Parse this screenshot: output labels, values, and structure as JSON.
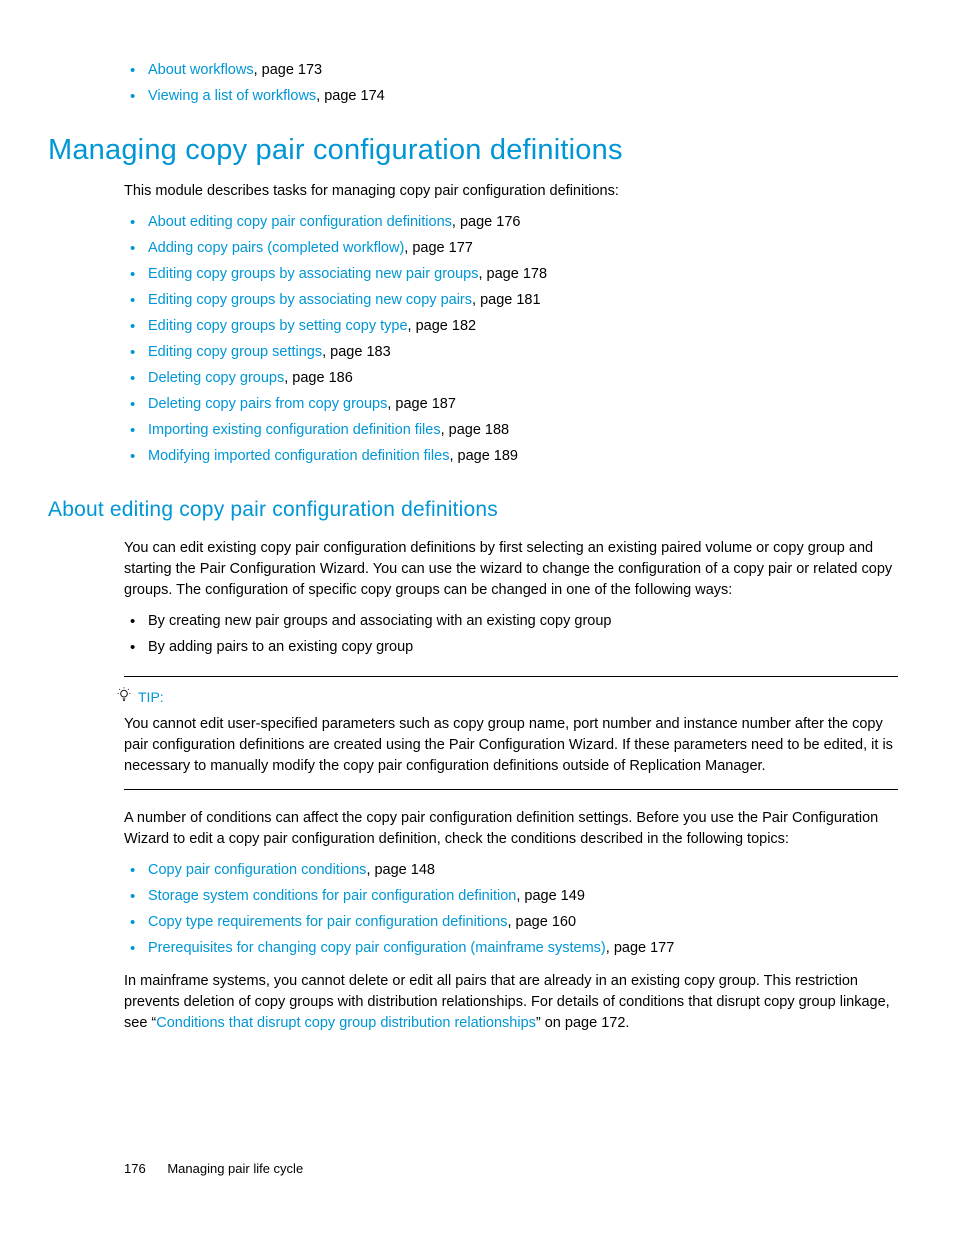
{
  "top_list": [
    {
      "link": "About workflows",
      "suffix": ", page 173"
    },
    {
      "link": "Viewing a list of workflows",
      "suffix": ", page 174"
    }
  ],
  "h1": "Managing copy pair configuration definitions",
  "intro_para": "This module describes tasks for managing copy pair configuration definitions:",
  "main_list": [
    {
      "link": "About editing copy pair configuration definitions",
      "suffix": ", page 176"
    },
    {
      "link": "Adding copy pairs (completed workflow)",
      "suffix": ", page 177"
    },
    {
      "link": "Editing copy groups by associating new pair groups",
      "suffix": ", page 178"
    },
    {
      "link": "Editing copy groups by associating new copy pairs",
      "suffix": ", page 181"
    },
    {
      "link": "Editing copy groups by setting copy type",
      "suffix": ", page 182"
    },
    {
      "link": "Editing copy group settings",
      "suffix": ", page 183"
    },
    {
      "link": "Deleting copy groups",
      "suffix": ", page 186"
    },
    {
      "link": "Deleting copy pairs from copy groups",
      "suffix": ", page 187"
    },
    {
      "link": "Importing existing configuration definition files",
      "suffix": ", page 188"
    },
    {
      "link": "Modifying imported configuration definition files",
      "suffix": ", page 189"
    }
  ],
  "h2": "About editing copy pair configuration definitions",
  "edit_para": "You can edit existing copy pair configuration definitions by first selecting an existing paired volume or copy group and starting the Pair Configuration Wizard. You can use the wizard to change the configuration of a copy pair or related copy groups. The configuration of specific copy groups can be changed in one of the following ways:",
  "ways_list": [
    "By creating new pair groups and associating with an existing copy group",
    "By adding pairs to an existing copy group"
  ],
  "tip_label": "TIP:",
  "tip_body": "You cannot edit user-specified parameters such as copy group name, port number and instance number after the copy pair configuration definitions are created using the Pair Configuration Wizard. If these parameters need to be edited, it is necessary to manually modify the copy pair configuration definitions outside of Replication Manager.",
  "conditions_para": "A number of conditions can affect the copy pair configuration definition settings. Before you use the Pair Configuration Wizard to edit a copy pair configuration definition, check the conditions described in the following topics:",
  "conditions_list": [
    {
      "link": "Copy pair configuration conditions",
      "suffix": ", page 148"
    },
    {
      "link": "Storage system conditions for pair configuration definition",
      "suffix": ", page 149"
    },
    {
      "link": "Copy type requirements for pair configuration definitions",
      "suffix": ", page 160"
    },
    {
      "link": "Prerequisites for changing copy pair configuration (mainframe systems)",
      "suffix": ", page 177"
    }
  ],
  "mainframe_para_before": " In mainframe systems, you cannot delete or edit all pairs that are already in an existing copy group. This restriction prevents deletion of copy groups with distribution relationships. For details of conditions that disrupt copy group linkage, see “",
  "mainframe_link": "Conditions that disrupt copy group distribution relationships",
  "mainframe_para_after": "” on page 172.",
  "footer": {
    "page": "176",
    "section": "Managing pair life cycle"
  }
}
